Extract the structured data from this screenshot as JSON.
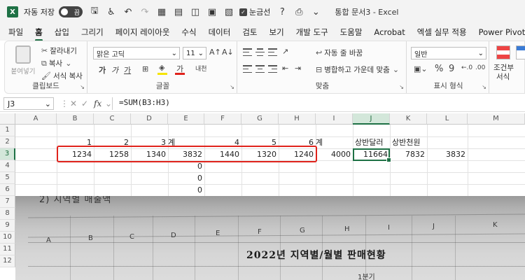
{
  "titlebar": {
    "app_icon": "X",
    "autosave_label": "자동 저장",
    "autosave_state": "끔",
    "gridlines_label": "눈금선",
    "document_title": "통합 문서3  -  Excel"
  },
  "menu": [
    "파일",
    "홈",
    "삽입",
    "그리기",
    "페이지 레이아웃",
    "수식",
    "데이터",
    "검토",
    "보기",
    "개발 도구",
    "도움말",
    "Acrobat",
    "엑셀 실무 적용",
    "Power Pivot"
  ],
  "ribbon": {
    "clipboard": {
      "paste": "붙여넣기",
      "cut": "잘라내기",
      "copy": "복사",
      "format_painter": "서식 복사",
      "label": "클립보드"
    },
    "font": {
      "name": "맑은 고딕",
      "size": "11",
      "label": "글꼴",
      "bold": "가",
      "italic": "가",
      "underline": "가",
      "font_color": "가",
      "phonetic": "내천"
    },
    "alignment": {
      "wrap": "자동 줄 바꿈",
      "merge": "병합하고 가운데 맞춤",
      "label": "맞춤"
    },
    "number": {
      "format": "일반",
      "label": "표시 형식",
      "percent": "%",
      "comma": "9"
    },
    "styles": {
      "conditional": "조건부",
      "conditional2": "서식"
    }
  },
  "formula_bar": {
    "name_box": "J3",
    "fx": "fx",
    "formula": "=SUM(B3:H3)"
  },
  "grid": {
    "columns": [
      "A",
      "B",
      "C",
      "D",
      "E",
      "F",
      "G",
      "H",
      "I",
      "J",
      "K",
      "L",
      "M"
    ],
    "rows": [
      "1",
      "2",
      "3",
      "4",
      "5",
      "6",
      "7",
      "8",
      "9",
      "10",
      "11",
      "12"
    ],
    "row2": {
      "b": "1",
      "c": "2",
      "d": "3",
      "e": "계",
      "f": "4",
      "g": "5",
      "h": "6",
      "i": "계",
      "j": "상반달러",
      "k": "상반천원"
    },
    "row3": {
      "b": "1234",
      "c": "1258",
      "d": "1340",
      "e": "3832",
      "f": "1440",
      "g": "1320",
      "h": "1240",
      "i": "4000",
      "j": "11664",
      "k": "7832",
      "l": "3832"
    },
    "e4": "0",
    "e5": "0",
    "e6": "0"
  },
  "photo": {
    "caption": "2) 지역별 매출액",
    "columns": [
      "A",
      "B",
      "C",
      "D",
      "E",
      "F",
      "G",
      "H",
      "I",
      "J",
      "K"
    ],
    "title": "2022년 지역별/월별 판매현황",
    "sub": "1분기"
  }
}
